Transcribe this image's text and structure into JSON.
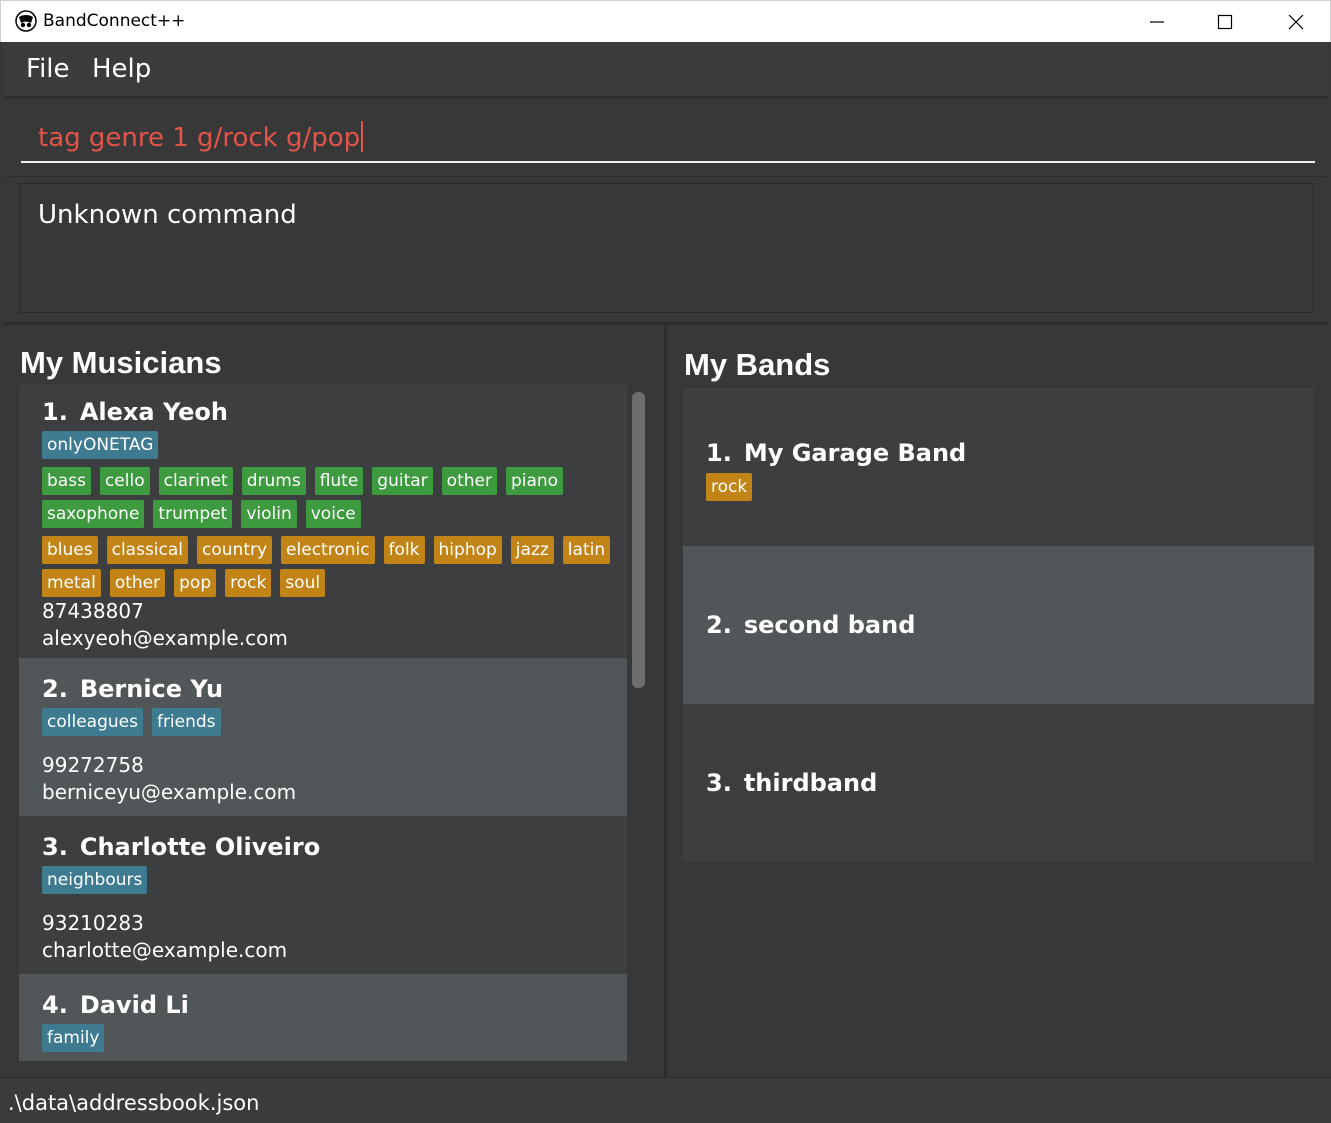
{
  "window": {
    "title": "BandConnect++",
    "icon": "app-logo-icon",
    "controls": [
      "minimize-icon",
      "maximize-icon",
      "close-icon"
    ]
  },
  "menu": {
    "file": "File",
    "help": "Help"
  },
  "command": {
    "value": "tag genre 1 g/rock g/pop"
  },
  "result": {
    "text": "Unknown command"
  },
  "musicians": {
    "title": "My Musicians",
    "items": [
      {
        "index": "1.",
        "name": "Alexa Yeoh",
        "tags": [
          "onlyONETAG"
        ],
        "instruments_row1": [
          "bass",
          "cello",
          "clarinet",
          "drums",
          "flute",
          "guitar",
          "other",
          "piano"
        ],
        "instruments_row2": [
          "saxophone",
          "trumpet",
          "violin",
          "voice"
        ],
        "genres_row1": [
          "blues",
          "classical",
          "country",
          "electronic",
          "folk",
          "hiphop",
          "jazz",
          "latin"
        ],
        "genres_row2": [
          "metal",
          "other",
          "pop",
          "rock",
          "soul"
        ],
        "phone": "87438807",
        "email": "alexyeoh@example.com"
      },
      {
        "index": "2.",
        "name": "Bernice Yu",
        "tags": [
          "colleagues",
          "friends"
        ],
        "phone": "99272758",
        "email": "berniceyu@example.com"
      },
      {
        "index": "3.",
        "name": "Charlotte Oliveiro",
        "tags": [
          "neighbours"
        ],
        "phone": "93210283",
        "email": "charlotte@example.com"
      },
      {
        "index": "4.",
        "name": "David Li",
        "tags": [
          "family"
        ]
      }
    ]
  },
  "bands": {
    "title": "My Bands",
    "items": [
      {
        "index": "1.",
        "name": "My Garage Band",
        "genres": [
          "rock"
        ]
      },
      {
        "index": "2.",
        "name": "second band",
        "genres": []
      },
      {
        "index": "3.",
        "name": "thirdband",
        "genres": []
      }
    ]
  },
  "status": {
    "path": ".\\data\\addressbook.json"
  },
  "colors": {
    "tag_blue": "#3e7b91",
    "tag_green": "#3e9a3f",
    "tag_orange": "#c28417",
    "command_text": "#e2544a",
    "background": "#383838"
  }
}
